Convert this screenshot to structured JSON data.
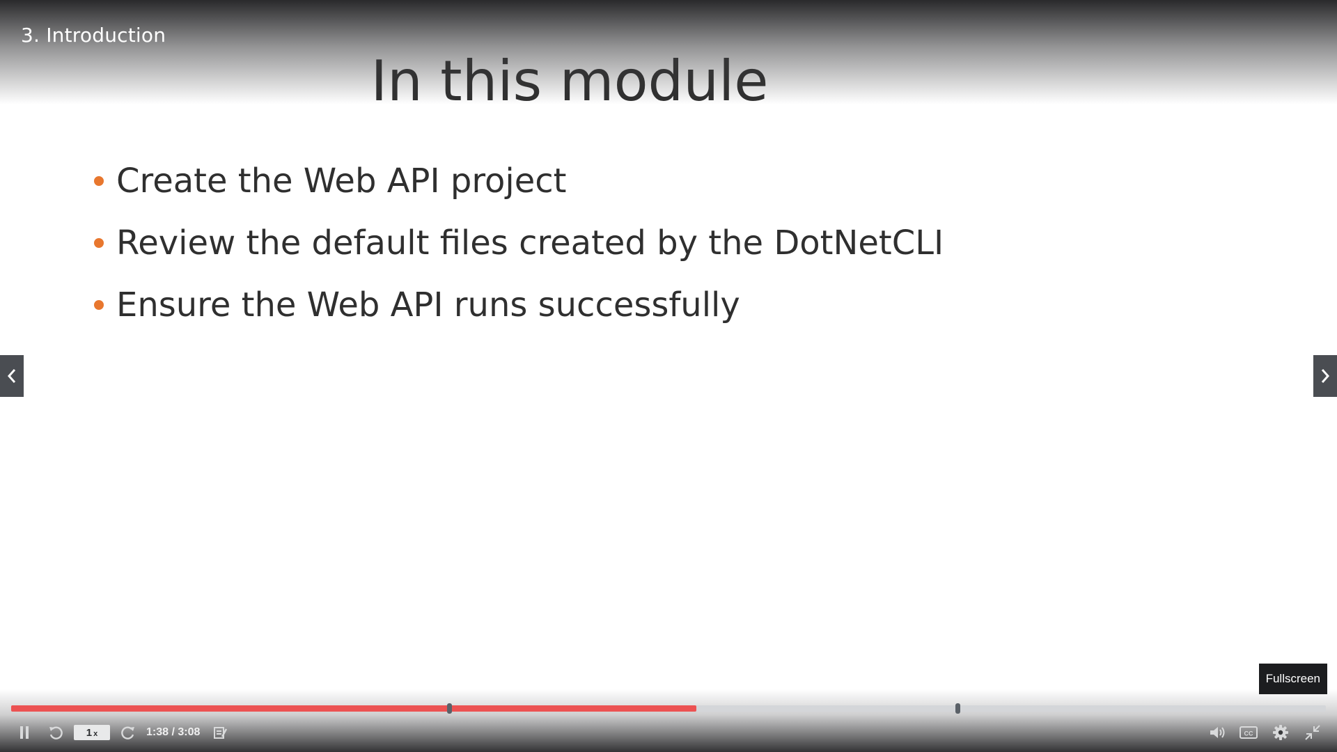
{
  "lecture": {
    "title": "3. Introduction"
  },
  "slide": {
    "title": "In this module",
    "bullets": [
      "Create the Web API project",
      "Review the default files created by the DotNetCLI",
      "Ensure the Web API runs successfully"
    ],
    "bullet_color": "#e8772e"
  },
  "player": {
    "tooltip": "Fullscreen",
    "speed": "1",
    "speed_suffix": "x",
    "current_time": "1:38",
    "duration": "3:08",
    "time_display": "1:38 / 3:08",
    "progress_fraction": 0.521,
    "bookmarks": [
      0.333,
      0.72
    ],
    "progress_color": "#ec5252",
    "icons": {
      "pause": "pause-icon",
      "rewind": "rewind-icon",
      "forward": "forward-icon",
      "notes": "notes-icon",
      "volume": "volume-icon",
      "captions": "captions-icon",
      "settings": "gear-icon",
      "fullscreen": "exit-fullscreen-icon",
      "prev": "chevron-left-icon",
      "next": "chevron-right-icon"
    }
  }
}
